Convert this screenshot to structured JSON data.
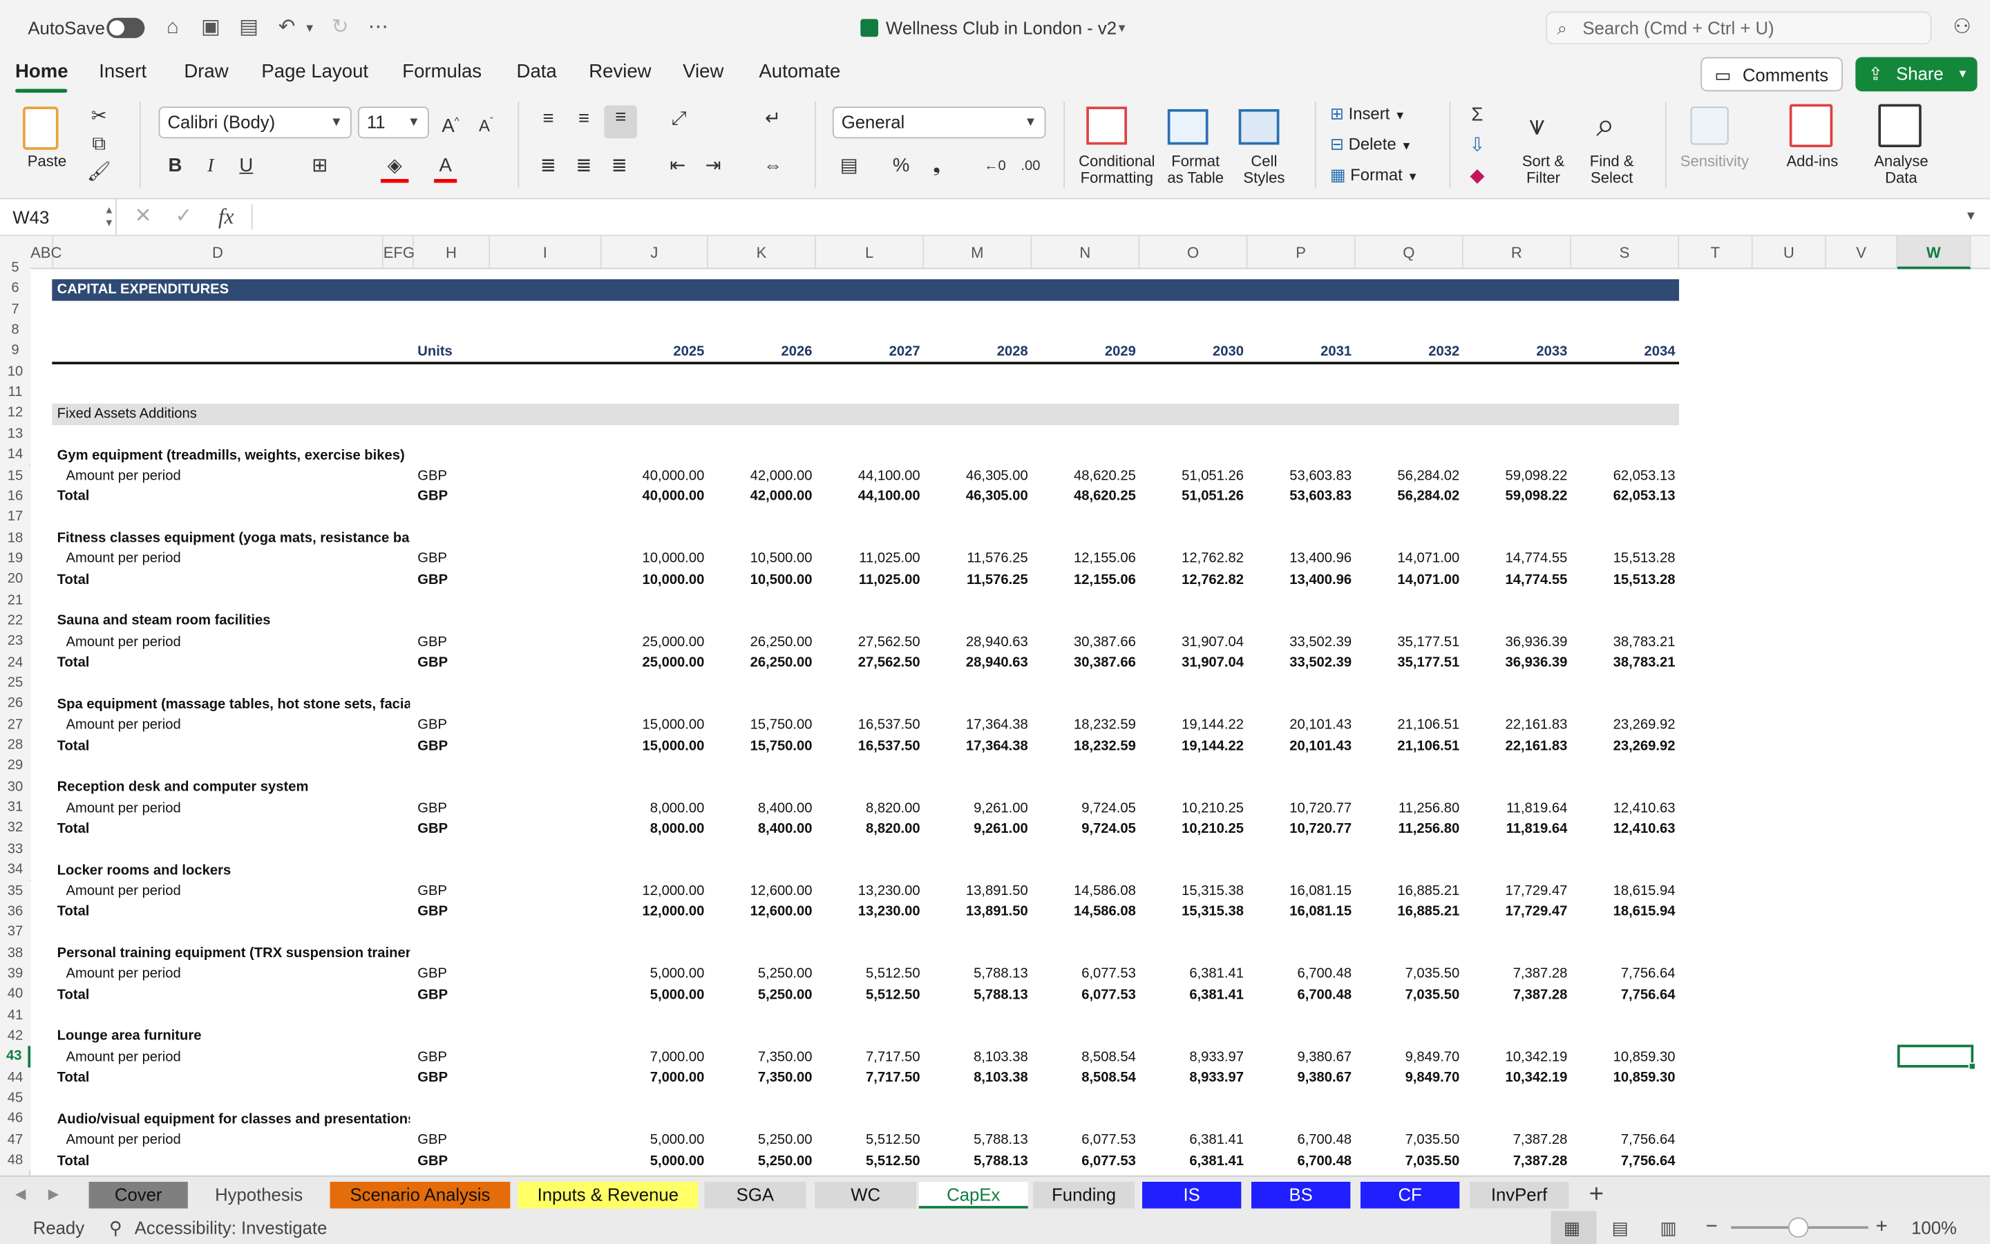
{
  "titlebar": {
    "autosave": "AutoSave",
    "doc_title": "Wellness Club in London - v2",
    "search_placeholder": "Search (Cmd + Ctrl + U)"
  },
  "tabs": [
    "Home",
    "Insert",
    "Draw",
    "Page Layout",
    "Formulas",
    "Data",
    "Review",
    "View",
    "Automate"
  ],
  "buttons": {
    "comments": "Comments",
    "share": "Share"
  },
  "ribbon": {
    "paste": "Paste",
    "font": "Calibri (Body)",
    "size": "11",
    "number_format": "General",
    "conditional": "Conditional",
    "formatting": "Formatting",
    "format": "Format",
    "as_table": "as Table",
    "cell": "Cell",
    "styles": "Styles",
    "insert": "Insert",
    "delete": "Delete",
    "format_cells": "Format",
    "sort": "Sort &",
    "filter": "Filter",
    "find": "Find &",
    "select": "Select",
    "sensitivity": "Sensitivity",
    "addins": "Add-ins",
    "analyse": "Analyse",
    "data": "Data",
    "bold": "B",
    "italic": "I",
    "underline": "U"
  },
  "formula_bar": {
    "name_box": "W43",
    "fx": "fx",
    "value": ""
  },
  "columns": [
    "ABC",
    "D",
    "EFG",
    "H",
    "I",
    "J",
    "K",
    "L",
    "M",
    "N",
    "O",
    "P",
    "Q",
    "R",
    "S",
    "T",
    "U",
    "V",
    "W"
  ],
  "rows": [
    "5",
    "6",
    "7",
    "8",
    "9",
    "10",
    "11",
    "12",
    "13",
    "14",
    "15",
    "16",
    "17",
    "18",
    "19",
    "20",
    "21",
    "22",
    "23",
    "24",
    "25",
    "26",
    "27",
    "28",
    "29",
    "30",
    "31",
    "32",
    "33",
    "34",
    "35",
    "36",
    "37",
    "38",
    "39",
    "40",
    "41",
    "42",
    "43",
    "44",
    "45",
    "46",
    "47",
    "48"
  ],
  "sheet": {
    "banner": "CAPITAL EXPENDITURES",
    "units_label": "Units",
    "years": [
      "2025",
      "2026",
      "2027",
      "2028",
      "2029",
      "2030",
      "2031",
      "2032",
      "2033",
      "2034"
    ],
    "section": "Fixed Assets Additions",
    "amount_label": "Amount per period",
    "total_label": "Total",
    "unit": "GBP",
    "groups": [
      {
        "name": "Gym equipment (treadmills, weights, exercise bikes)",
        "values": [
          "40,000.00",
          "42,000.00",
          "44,100.00",
          "46,305.00",
          "48,620.25",
          "51,051.26",
          "53,603.83",
          "56,284.02",
          "59,098.22",
          "62,053.13"
        ]
      },
      {
        "name": "Fitness classes equipment (yoga mats, resistance bands,",
        "values": [
          "10,000.00",
          "10,500.00",
          "11,025.00",
          "11,576.25",
          "12,155.06",
          "12,762.82",
          "13,400.96",
          "14,071.00",
          "14,774.55",
          "15,513.28"
        ]
      },
      {
        "name": "Sauna and steam room facilities",
        "values": [
          "25,000.00",
          "26,250.00",
          "27,562.50",
          "28,940.63",
          "30,387.66",
          "31,907.04",
          "33,502.39",
          "35,177.51",
          "36,936.39",
          "38,783.21"
        ]
      },
      {
        "name": "Spa equipment (massage tables, hot stone sets, facial ste",
        "values": [
          "15,000.00",
          "15,750.00",
          "16,537.50",
          "17,364.38",
          "18,232.59",
          "19,144.22",
          "20,101.43",
          "21,106.51",
          "22,161.83",
          "23,269.92"
        ]
      },
      {
        "name": "Reception desk and computer system",
        "values": [
          "8,000.00",
          "8,400.00",
          "8,820.00",
          "9,261.00",
          "9,724.05",
          "10,210.25",
          "10,720.77",
          "11,256.80",
          "11,819.64",
          "12,410.63"
        ]
      },
      {
        "name": "Locker rooms and lockers",
        "values": [
          "12,000.00",
          "12,600.00",
          "13,230.00",
          "13,891.50",
          "14,586.08",
          "15,315.38",
          "16,081.15",
          "16,885.21",
          "17,729.47",
          "18,615.94"
        ]
      },
      {
        "name": "Personal training equipment (TRX suspension trainers, b",
        "values": [
          "5,000.00",
          "5,250.00",
          "5,512.50",
          "5,788.13",
          "6,077.53",
          "6,381.41",
          "6,700.48",
          "7,035.50",
          "7,387.28",
          "7,756.64"
        ]
      },
      {
        "name": "Lounge area furniture",
        "values": [
          "7,000.00",
          "7,350.00",
          "7,717.50",
          "8,103.38",
          "8,508.54",
          "8,933.97",
          "9,380.67",
          "9,849.70",
          "10,342.19",
          "10,859.30"
        ]
      },
      {
        "name": "Audio/visual equipment for classes and presentations",
        "values": [
          "5,000.00",
          "5,250.00",
          "5,512.50",
          "5,788.13",
          "6,077.53",
          "6,381.41",
          "6,700.48",
          "7,035.50",
          "7,387.28",
          "7,756.64"
        ]
      }
    ]
  },
  "sheet_tabs": [
    {
      "name": "Cover",
      "bg": "#7f7f7f",
      "fg": "#111"
    },
    {
      "name": "Hypothesis",
      "bg": "#eaeaea",
      "fg": "#444"
    },
    {
      "name": "Scenario Analysis",
      "bg": "#e46c0a",
      "fg": "#111"
    },
    {
      "name": "Inputs & Revenue",
      "bg": "#ffff66",
      "fg": "#111"
    },
    {
      "name": "SGA",
      "bg": "#d9d9d9",
      "fg": "#111"
    },
    {
      "name": "WC",
      "bg": "#d9d9d9",
      "fg": "#111"
    },
    {
      "name": "CapEx",
      "bg": "#ffffff",
      "fg": "#107c41"
    },
    {
      "name": "Funding",
      "bg": "#d9d9d9",
      "fg": "#111"
    },
    {
      "name": "IS",
      "bg": "#1f1fff",
      "fg": "#fff"
    },
    {
      "name": "BS",
      "bg": "#1f1fff",
      "fg": "#fff"
    },
    {
      "name": "CF",
      "bg": "#1f1fff",
      "fg": "#fff"
    },
    {
      "name": "InvPerf",
      "bg": "#d9d9d9",
      "fg": "#111"
    }
  ],
  "status": {
    "ready": "Ready",
    "accessibility": "Accessibility: Investigate",
    "zoom": "100%"
  },
  "colors": {
    "banner": "#2f4a73",
    "accent": "#107c41",
    "section_bg": "#e0e0e0"
  }
}
